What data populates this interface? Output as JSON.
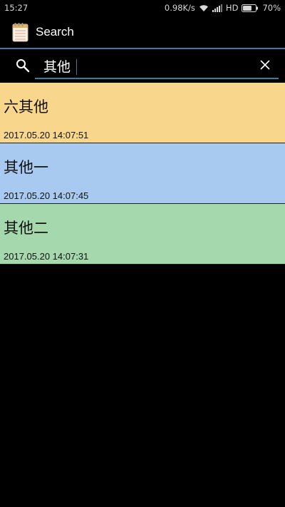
{
  "status_bar": {
    "time": "15:27",
    "network_speed": "0.98K/s",
    "network_type": "HD",
    "battery_percent": "70%",
    "battery_level": 0.7,
    "icons": [
      "wifi-icon",
      "signal-icon",
      "battery-icon"
    ]
  },
  "app_bar": {
    "title": "Search",
    "icon": "notepad-icon"
  },
  "search": {
    "query": "其他",
    "search_icon": "search-icon",
    "clear_icon": "close-icon"
  },
  "notes": [
    {
      "title": "六其他",
      "date": "2017.05.20 14:07:51",
      "color": "#f8d68b"
    },
    {
      "title": "其他一",
      "date": "2017.05.20 14:07:45",
      "color": "#a8caf0"
    },
    {
      "title": "其他二",
      "date": "2017.05.20 14:07:31",
      "color": "#a6d8ae"
    }
  ],
  "colors": {
    "accent": "#2f7ea8",
    "background": "#000000"
  }
}
